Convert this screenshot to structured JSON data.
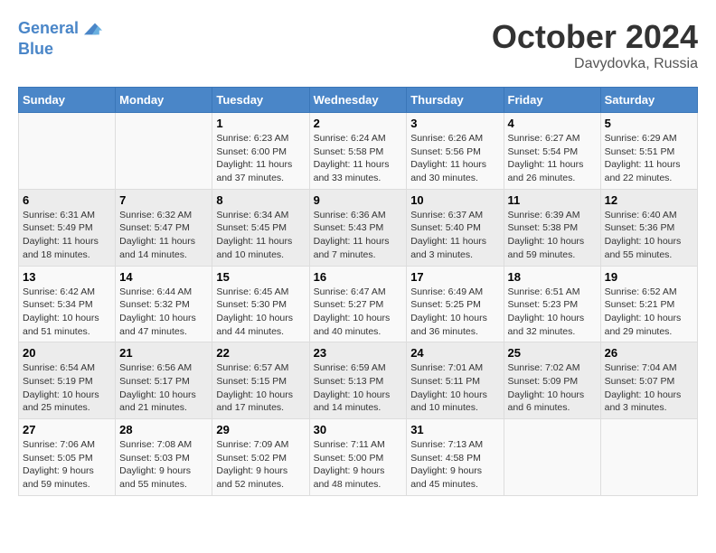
{
  "header": {
    "logo_line1": "General",
    "logo_line2": "Blue",
    "month_title": "October 2024",
    "location": "Davydovka, Russia"
  },
  "weekdays": [
    "Sunday",
    "Monday",
    "Tuesday",
    "Wednesday",
    "Thursday",
    "Friday",
    "Saturday"
  ],
  "weeks": [
    [
      {
        "day": "",
        "sunrise": "",
        "sunset": "",
        "daylight": ""
      },
      {
        "day": "",
        "sunrise": "",
        "sunset": "",
        "daylight": ""
      },
      {
        "day": "1",
        "sunrise": "Sunrise: 6:23 AM",
        "sunset": "Sunset: 6:00 PM",
        "daylight": "Daylight: 11 hours and 37 minutes."
      },
      {
        "day": "2",
        "sunrise": "Sunrise: 6:24 AM",
        "sunset": "Sunset: 5:58 PM",
        "daylight": "Daylight: 11 hours and 33 minutes."
      },
      {
        "day": "3",
        "sunrise": "Sunrise: 6:26 AM",
        "sunset": "Sunset: 5:56 PM",
        "daylight": "Daylight: 11 hours and 30 minutes."
      },
      {
        "day": "4",
        "sunrise": "Sunrise: 6:27 AM",
        "sunset": "Sunset: 5:54 PM",
        "daylight": "Daylight: 11 hours and 26 minutes."
      },
      {
        "day": "5",
        "sunrise": "Sunrise: 6:29 AM",
        "sunset": "Sunset: 5:51 PM",
        "daylight": "Daylight: 11 hours and 22 minutes."
      }
    ],
    [
      {
        "day": "6",
        "sunrise": "Sunrise: 6:31 AM",
        "sunset": "Sunset: 5:49 PM",
        "daylight": "Daylight: 11 hours and 18 minutes."
      },
      {
        "day": "7",
        "sunrise": "Sunrise: 6:32 AM",
        "sunset": "Sunset: 5:47 PM",
        "daylight": "Daylight: 11 hours and 14 minutes."
      },
      {
        "day": "8",
        "sunrise": "Sunrise: 6:34 AM",
        "sunset": "Sunset: 5:45 PM",
        "daylight": "Daylight: 11 hours and 10 minutes."
      },
      {
        "day": "9",
        "sunrise": "Sunrise: 6:36 AM",
        "sunset": "Sunset: 5:43 PM",
        "daylight": "Daylight: 11 hours and 7 minutes."
      },
      {
        "day": "10",
        "sunrise": "Sunrise: 6:37 AM",
        "sunset": "Sunset: 5:40 PM",
        "daylight": "Daylight: 11 hours and 3 minutes."
      },
      {
        "day": "11",
        "sunrise": "Sunrise: 6:39 AM",
        "sunset": "Sunset: 5:38 PM",
        "daylight": "Daylight: 10 hours and 59 minutes."
      },
      {
        "day": "12",
        "sunrise": "Sunrise: 6:40 AM",
        "sunset": "Sunset: 5:36 PM",
        "daylight": "Daylight: 10 hours and 55 minutes."
      }
    ],
    [
      {
        "day": "13",
        "sunrise": "Sunrise: 6:42 AM",
        "sunset": "Sunset: 5:34 PM",
        "daylight": "Daylight: 10 hours and 51 minutes."
      },
      {
        "day": "14",
        "sunrise": "Sunrise: 6:44 AM",
        "sunset": "Sunset: 5:32 PM",
        "daylight": "Daylight: 10 hours and 47 minutes."
      },
      {
        "day": "15",
        "sunrise": "Sunrise: 6:45 AM",
        "sunset": "Sunset: 5:30 PM",
        "daylight": "Daylight: 10 hours and 44 minutes."
      },
      {
        "day": "16",
        "sunrise": "Sunrise: 6:47 AM",
        "sunset": "Sunset: 5:27 PM",
        "daylight": "Daylight: 10 hours and 40 minutes."
      },
      {
        "day": "17",
        "sunrise": "Sunrise: 6:49 AM",
        "sunset": "Sunset: 5:25 PM",
        "daylight": "Daylight: 10 hours and 36 minutes."
      },
      {
        "day": "18",
        "sunrise": "Sunrise: 6:51 AM",
        "sunset": "Sunset: 5:23 PM",
        "daylight": "Daylight: 10 hours and 32 minutes."
      },
      {
        "day": "19",
        "sunrise": "Sunrise: 6:52 AM",
        "sunset": "Sunset: 5:21 PM",
        "daylight": "Daylight: 10 hours and 29 minutes."
      }
    ],
    [
      {
        "day": "20",
        "sunrise": "Sunrise: 6:54 AM",
        "sunset": "Sunset: 5:19 PM",
        "daylight": "Daylight: 10 hours and 25 minutes."
      },
      {
        "day": "21",
        "sunrise": "Sunrise: 6:56 AM",
        "sunset": "Sunset: 5:17 PM",
        "daylight": "Daylight: 10 hours and 21 minutes."
      },
      {
        "day": "22",
        "sunrise": "Sunrise: 6:57 AM",
        "sunset": "Sunset: 5:15 PM",
        "daylight": "Daylight: 10 hours and 17 minutes."
      },
      {
        "day": "23",
        "sunrise": "Sunrise: 6:59 AM",
        "sunset": "Sunset: 5:13 PM",
        "daylight": "Daylight: 10 hours and 14 minutes."
      },
      {
        "day": "24",
        "sunrise": "Sunrise: 7:01 AM",
        "sunset": "Sunset: 5:11 PM",
        "daylight": "Daylight: 10 hours and 10 minutes."
      },
      {
        "day": "25",
        "sunrise": "Sunrise: 7:02 AM",
        "sunset": "Sunset: 5:09 PM",
        "daylight": "Daylight: 10 hours and 6 minutes."
      },
      {
        "day": "26",
        "sunrise": "Sunrise: 7:04 AM",
        "sunset": "Sunset: 5:07 PM",
        "daylight": "Daylight: 10 hours and 3 minutes."
      }
    ],
    [
      {
        "day": "27",
        "sunrise": "Sunrise: 7:06 AM",
        "sunset": "Sunset: 5:05 PM",
        "daylight": "Daylight: 9 hours and 59 minutes."
      },
      {
        "day": "28",
        "sunrise": "Sunrise: 7:08 AM",
        "sunset": "Sunset: 5:03 PM",
        "daylight": "Daylight: 9 hours and 55 minutes."
      },
      {
        "day": "29",
        "sunrise": "Sunrise: 7:09 AM",
        "sunset": "Sunset: 5:02 PM",
        "daylight": "Daylight: 9 hours and 52 minutes."
      },
      {
        "day": "30",
        "sunrise": "Sunrise: 7:11 AM",
        "sunset": "Sunset: 5:00 PM",
        "daylight": "Daylight: 9 hours and 48 minutes."
      },
      {
        "day": "31",
        "sunrise": "Sunrise: 7:13 AM",
        "sunset": "Sunset: 4:58 PM",
        "daylight": "Daylight: 9 hours and 45 minutes."
      },
      {
        "day": "",
        "sunrise": "",
        "sunset": "",
        "daylight": ""
      },
      {
        "day": "",
        "sunrise": "",
        "sunset": "",
        "daylight": ""
      }
    ]
  ]
}
